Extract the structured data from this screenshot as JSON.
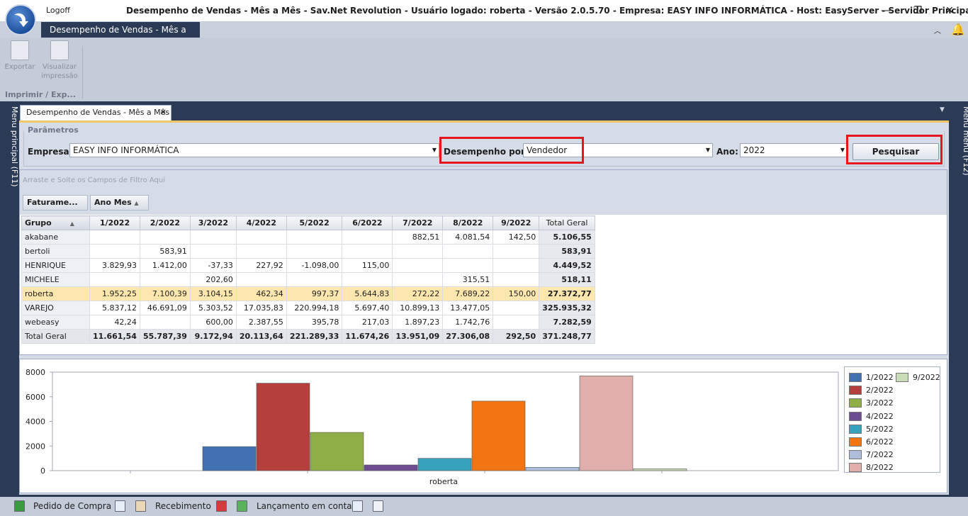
{
  "window": {
    "logoff_label": "Logoff",
    "title": "Desempenho de Vendas - Mês a Mês - Sav.Net Revolution - Usuário logado: roberta - Versão 2.0.5.70 - Empresa: EASY INFO INFORMÁTICA - Host: EasyServer - Servidor Principal:[SIM]",
    "minimize": "—",
    "restore": "❐",
    "close": "✕"
  },
  "ribbon": {
    "tab": "Desempenho de Vendas - Mês a Mês",
    "export_label": "Exportar",
    "preview_label_1": "Visualizar",
    "preview_label_2": "impressão",
    "group_label": "Imprimir / Exp..."
  },
  "side": {
    "left": "Menu principal (F11)",
    "right": "Menu menu (F12)"
  },
  "doc_tab": {
    "label": "Desempenho de Vendas - Mês a Mês",
    "close": "✕"
  },
  "params": {
    "title": "Parâmetros",
    "empresa_label": "Empresa:",
    "empresa_value": "EASY INFO INFORMÁTICA",
    "desempenho_label": "Desempenho por:",
    "desempenho_value": "Vendedor",
    "ano_label": "Ano:",
    "ano_value": "2022",
    "search_button": "Pesquisar"
  },
  "pivot": {
    "drop_hint": "Arraste e Solte os Campos de Filtro Aqui",
    "filter_field": "Faturame...",
    "column_field": "Ano Mes",
    "row_field": "Grupo",
    "columns": [
      "1/2022",
      "2/2022",
      "3/2022",
      "4/2022",
      "5/2022",
      "6/2022",
      "7/2022",
      "8/2022",
      "9/2022",
      "Total Geral"
    ],
    "rows": [
      {
        "name": "akabane",
        "cells": [
          "",
          "",
          "",
          "",
          "",
          "",
          "882,51",
          "4.081,54",
          "142,50",
          "5.106,55"
        ]
      },
      {
        "name": "bertoli",
        "cells": [
          "",
          "583,91",
          "",
          "",
          "",
          "",
          "",
          "",
          "",
          "583,91"
        ]
      },
      {
        "name": "HENRIQUE",
        "cells": [
          "3.829,93",
          "1.412,00",
          "-37,33",
          "227,92",
          "-1.098,00",
          "115,00",
          "",
          "",
          "",
          "4.449,52"
        ]
      },
      {
        "name": "MICHELE",
        "cells": [
          "",
          "",
          "202,60",
          "",
          "",
          "",
          "",
          "315,51",
          "",
          "518,11"
        ]
      },
      {
        "name": "roberta",
        "cells": [
          "1.952,25",
          "7.100,39",
          "3.104,15",
          "462,34",
          "997,37",
          "5.644,83",
          "272,22",
          "7.689,22",
          "150,00",
          "27.372,77"
        ]
      },
      {
        "name": "VAREJO",
        "cells": [
          "5.837,12",
          "46.691,09",
          "5.303,52",
          "17.035,83",
          "220.994,18",
          "5.697,40",
          "10.899,13",
          "13.477,05",
          "",
          "325.935,32"
        ]
      },
      {
        "name": "webeasy",
        "cells": [
          "42,24",
          "",
          "600,00",
          "2.387,55",
          "395,78",
          "217,03",
          "1.897,23",
          "1.742,76",
          "",
          "7.282,59"
        ]
      }
    ],
    "grand_total": {
      "name": "Total Geral",
      "cells": [
        "11.661,54",
        "55.787,39",
        "9.172,94",
        "20.113,64",
        "221.289,33",
        "11.674,26",
        "13.951,09",
        "27.306,08",
        "292,50",
        "371.248,77"
      ]
    }
  },
  "chart_data": {
    "type": "bar",
    "categories": [
      "roberta"
    ],
    "ylim": [
      0,
      8000
    ],
    "yticks": [
      "8000",
      "6000",
      "4000",
      "2000",
      "0"
    ],
    "legend_position": "right",
    "series": [
      {
        "name": "1/2022",
        "values": [
          1952.25
        ],
        "color": "#4271b1"
      },
      {
        "name": "2/2022",
        "values": [
          7100.39
        ],
        "color": "#b53f3c"
      },
      {
        "name": "3/2022",
        "values": [
          3104.15
        ],
        "color": "#8fae46"
      },
      {
        "name": "4/2022",
        "values": [
          462.34
        ],
        "color": "#6d4c92"
      },
      {
        "name": "5/2022",
        "values": [
          997.37
        ],
        "color": "#36a2bb"
      },
      {
        "name": "6/2022",
        "values": [
          5644.83
        ],
        "color": "#f17512"
      },
      {
        "name": "7/2022",
        "values": [
          272.22
        ],
        "color": "#aebdd9"
      },
      {
        "name": "8/2022",
        "values": [
          7689.22
        ],
        "color": "#e0aeab"
      },
      {
        "name": "9/2022",
        "values": [
          150.0
        ],
        "color": "#cadcb6"
      }
    ]
  },
  "statusbar": {
    "pedido": "Pedido de Compra",
    "recebimento": "Recebimento",
    "lancamento": "Lançamento em conta"
  }
}
